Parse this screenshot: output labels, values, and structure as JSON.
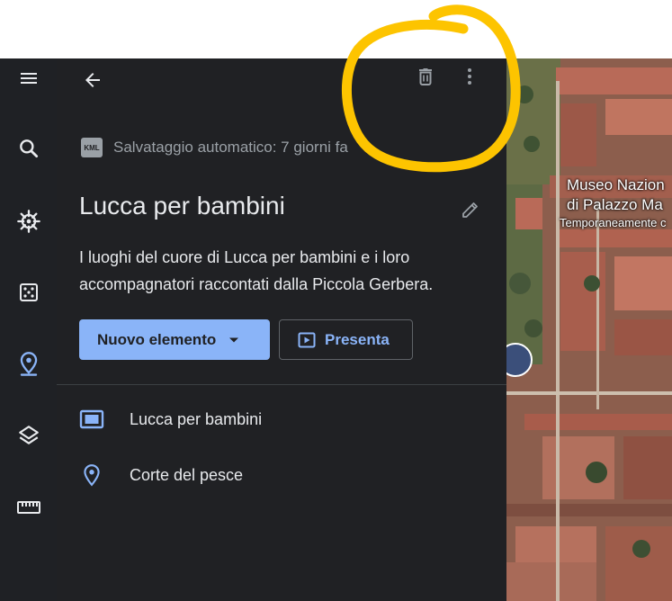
{
  "panel": {
    "autosave_badge": "KML",
    "autosave_text": "Salvataggio automatico: 7 giorni fa",
    "title": "Lucca per bambini",
    "description": "I luoghi del cuore di Lucca per bambini e i loro accompagnatori raccontati dalla Piccola Gerbera.",
    "new_item_label": "Nuovo elemento",
    "present_label": "Presenta",
    "items": [
      {
        "label": "Lucca per bambini",
        "icon": "slideshow-icon"
      },
      {
        "label": "Corte del pesce",
        "icon": "place-icon"
      }
    ]
  },
  "map": {
    "label_line1": "Museo Nazion",
    "label_line2": "di Palazzo Ma",
    "label_line3": "Temporaneamente c"
  },
  "colors": {
    "accent": "#8ab4f8",
    "panel_bg": "#202124",
    "rail_bg": "#1f2125",
    "annotation": "#fdc400"
  }
}
